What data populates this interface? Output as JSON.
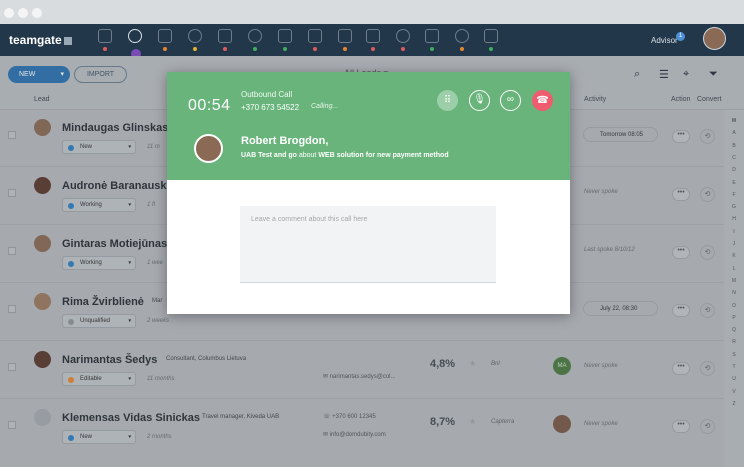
{
  "app": {
    "brand": "teamgate",
    "advisor_label": "Advisor",
    "advisor_badge": "1"
  },
  "toolbar": {
    "new_label": "NEW",
    "new_caret": "▾",
    "import_label": "IMPORT",
    "view_title": "All Leads ▾"
  },
  "columns": {
    "lead": "Lead",
    "activity": "Activity",
    "action": "Action",
    "convert": "Convert"
  },
  "alphabet": [
    "M",
    "A",
    "B",
    "C",
    "D",
    "E",
    "F",
    "G",
    "H",
    "I",
    "J",
    "K",
    "L",
    "M",
    "N",
    "O",
    "P",
    "Q",
    "R",
    "S",
    "T",
    "U",
    "V",
    "Z"
  ],
  "status_colors": {
    "New": "#2f7fc0",
    "Working": "#2f7fc0",
    "Unqualified": "#8e949a",
    "Editable": "#e8862f"
  },
  "brand_colors": {
    "call_header": "#68b47b",
    "hangup": "#ef5b6f",
    "navbar": "#23374a",
    "primary": "#2d72b0"
  },
  "leads": [
    {
      "name": "Mindaugas Glinskas",
      "position": "",
      "status": "New",
      "age": "11 m",
      "phone": "",
      "email": "",
      "probability": "",
      "company": "",
      "owner": "",
      "activity": "Tomorrow 08:05",
      "activity_pill": true
    },
    {
      "name": "Audronė Baranausk",
      "position": "",
      "status": "Working",
      "age": "1 fl",
      "phone": "",
      "email": "",
      "probability": "",
      "company": "",
      "owner": "",
      "activity": "Never spoke",
      "activity_pill": false
    },
    {
      "name": "Gintaras Motiejūnas",
      "position": "",
      "status": "Working",
      "age": "1 wee",
      "phone": "",
      "email": "",
      "probability": "",
      "company": "",
      "owner": "",
      "activity": "Last spoke 8/10/12",
      "activity_pill": false
    },
    {
      "name": "Rima Žvirblienė",
      "position": "Mar",
      "status": "Unqualified",
      "age": "2 weeks",
      "phone": "",
      "email": "",
      "probability": "",
      "company": "",
      "owner": "",
      "activity": "July 22, 08:30",
      "activity_pill": true
    },
    {
      "name": "Narimantas Šedys",
      "position": "Consultant, Columbus Lietuva",
      "status": "Editable",
      "age": "11 months",
      "phone": "",
      "email": "narimantas.sedys@col...",
      "probability": "4,8%",
      "company": "Bnl",
      "owner": "MA",
      "activity": "Never spoke",
      "activity_pill": false
    },
    {
      "name": "Klemensas Vidas Sinickas",
      "position": "Travel manager, Kiveda UAB",
      "status": "New",
      "age": "2 months",
      "phone": "+370 600 12345",
      "email": "info@domdubity.com",
      "probability": "8,7%",
      "company": "Capterra",
      "owner": "",
      "activity": "Never spoke",
      "activity_pill": false
    }
  ],
  "call": {
    "timer": "00:54",
    "direction": "Outbound Call",
    "number": "+370 673 54522",
    "status": "Calling...",
    "contact_name": "Robert Brogdon,",
    "contact_company": "UAB Test and go",
    "contact_about_word": "about",
    "contact_deal": "WEB solution for new payment method",
    "comment_placeholder": "Leave a comment about this call here"
  },
  "icons": [
    "search-icon",
    "list-icon",
    "pin-icon",
    "filter-icon",
    "keypad-icon",
    "mute-icon",
    "voicemail-icon",
    "hangup-icon"
  ]
}
